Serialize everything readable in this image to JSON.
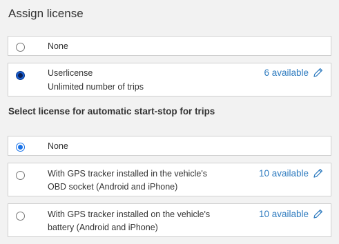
{
  "assign_license": {
    "title": "Assign license",
    "options": [
      {
        "label": "None",
        "selected": false
      },
      {
        "label_line1": "Userlicense",
        "label_line2": "Unlimited number of trips",
        "available": "6 available",
        "selected": true
      }
    ]
  },
  "auto_start_stop": {
    "title": "Select license for automatic start-stop for trips",
    "options": [
      {
        "label": "None",
        "selected": true
      },
      {
        "label_line1": "With GPS tracker installed in the vehicle's",
        "label_line2": "OBD socket (Android and iPhone)",
        "available": "10 available",
        "selected": false
      },
      {
        "label_line1": "With GPS tracker installed on the vehicle's",
        "label_line2": "battery (Android and iPhone)",
        "available": "10 available",
        "selected": false
      }
    ]
  },
  "icons": {
    "edit": "pencil-icon"
  },
  "colors": {
    "accent": "#1a73e8",
    "link": "#2e7bbf",
    "border": "#cfcfcf",
    "background": "#f2f2f2"
  }
}
